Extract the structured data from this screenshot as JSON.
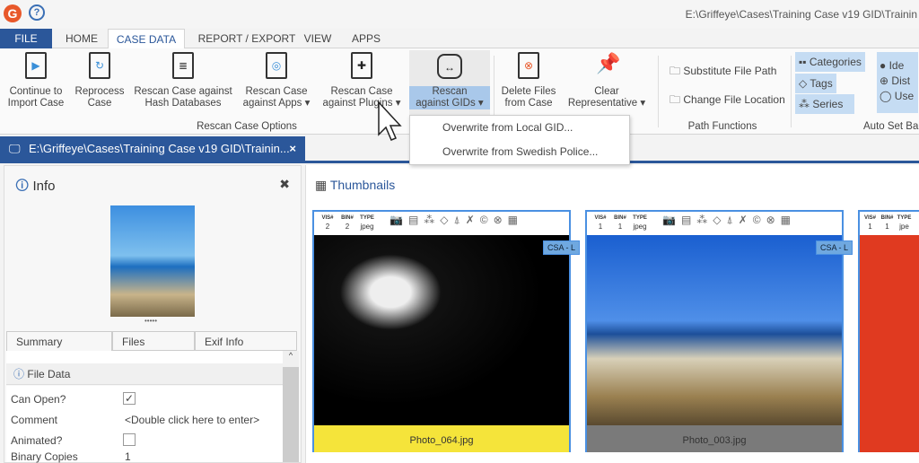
{
  "app": {
    "window_title": "E:\\Griffeye\\Cases\\Training Case v19 GID\\Trainin",
    "logo": "griffeye-logo",
    "help_icon": "question-icon"
  },
  "tabs": [
    "FILE",
    "HOME",
    "CASE DATA",
    "REPORT / EXPORT",
    "VIEW",
    "APPS"
  ],
  "ribbon": {
    "rescan_group": {
      "label": "Rescan Case Options",
      "buttons": [
        {
          "l1": "Continue to",
          "l2": "Import Case"
        },
        {
          "l1": "Reprocess",
          "l2": "Case"
        },
        {
          "l1": "Rescan Case against",
          "l2": "Hash Databases"
        },
        {
          "l1": "Rescan Case",
          "l2": "against Apps ▾"
        },
        {
          "l1": "Rescan Case",
          "l2": "against Plugins ▾"
        },
        {
          "l1": "Rescan",
          "l2": "against GIDs ▾"
        }
      ]
    },
    "delete": {
      "l1": "Delete Files",
      "l2": "from Case"
    },
    "clear": {
      "l1": "Clear",
      "l2": "Representative ▾"
    },
    "path_group": {
      "label": "Path Functions",
      "items": [
        "Substitute File Path",
        "Change File Location"
      ]
    },
    "autoset_group": {
      "label": "Auto Set Ba",
      "items": [
        "Categories",
        "Tags",
        "Series",
        "Ide",
        "Dist",
        "Use"
      ]
    }
  },
  "dropdown": [
    "Overwrite from Local GID...",
    "Overwrite from Swedish Police..."
  ],
  "doc_tab": {
    "title": "E:\\Griffeye\\Cases\\Training Case v19 GID\\Trainin...",
    "close": "×"
  },
  "info": {
    "title": "Info",
    "tabs": [
      "Summary",
      "Files",
      "Exif Info"
    ],
    "section": "File Data",
    "rows": [
      {
        "label": "Can Open?",
        "checked": true
      },
      {
        "label": "Comment",
        "value": "<Double click here to enter>"
      },
      {
        "label": "Animated?",
        "checked": false
      },
      {
        "label": "Binary Copies",
        "value": "1"
      }
    ]
  },
  "thumbnails": {
    "title": "Thumbnails",
    "col_labels": [
      "VIS#",
      "BIN#",
      "TYPE"
    ],
    "items": [
      {
        "vis": "2",
        "bin": "2",
        "type": "jpeg",
        "badge": "CSA - L",
        "name": "Photo_064.jpg",
        "caption_color": "#f5e43a"
      },
      {
        "vis": "1",
        "bin": "1",
        "type": "jpeg",
        "badge": "CSA - L",
        "name": "Photo_003.jpg",
        "caption_color": "#7a7a7a"
      },
      {
        "vis": "1",
        "bin": "1",
        "type": "jpe",
        "badge": "",
        "name": "",
        "caption_color": "#e03a20"
      }
    ]
  }
}
